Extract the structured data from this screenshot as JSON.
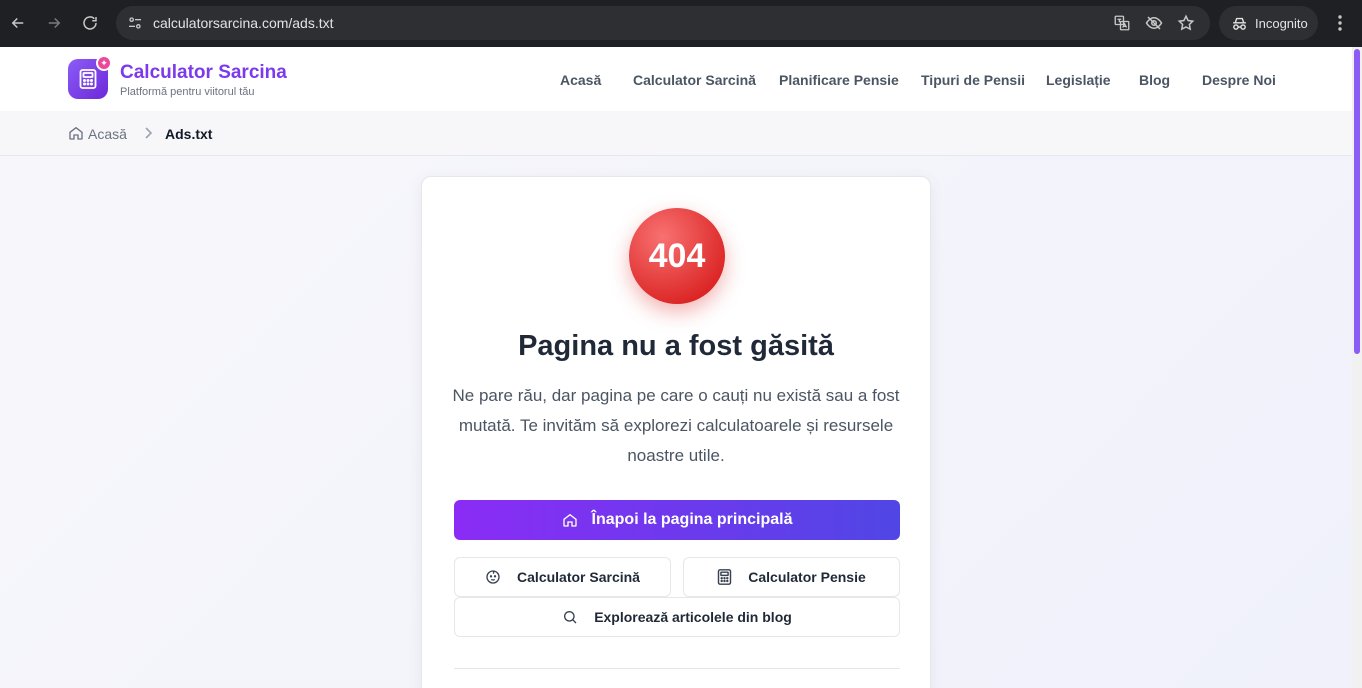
{
  "browser": {
    "url": "calculatorsarcina.com/ads.txt",
    "incognito_label": "Incognito"
  },
  "header": {
    "brand_name": "Calculator Sarcina",
    "brand_tagline": "Platformă pentru viitorul tău",
    "nav": [
      "Acasă",
      "Calculator Sarcină",
      "Planificare Pensie",
      "Tipuri de Pensii",
      "Legislație",
      "Blog",
      "Despre Noi"
    ]
  },
  "breadcrumb": {
    "home": "Acasă",
    "current": "Ads.txt"
  },
  "error": {
    "code": "404",
    "title": "Pagina nu a fost găsită",
    "description": "Ne pare rău, dar pagina pe care o cauți nu există sau a fost mutată. Te invităm să explorezi calculatoarele și resursele noastre utile.",
    "home_button": "Înapoi la pagina principală",
    "pregnancy_button": "Calculator Sarcină",
    "pension_button": "Calculator Pensie",
    "blog_button": "Explorează articolele din blog"
  },
  "colors": {
    "brand": "#7c3aed",
    "error": "#dc2626",
    "primary_button_start": "#8b2cf5",
    "primary_button_end": "#5046e5"
  }
}
